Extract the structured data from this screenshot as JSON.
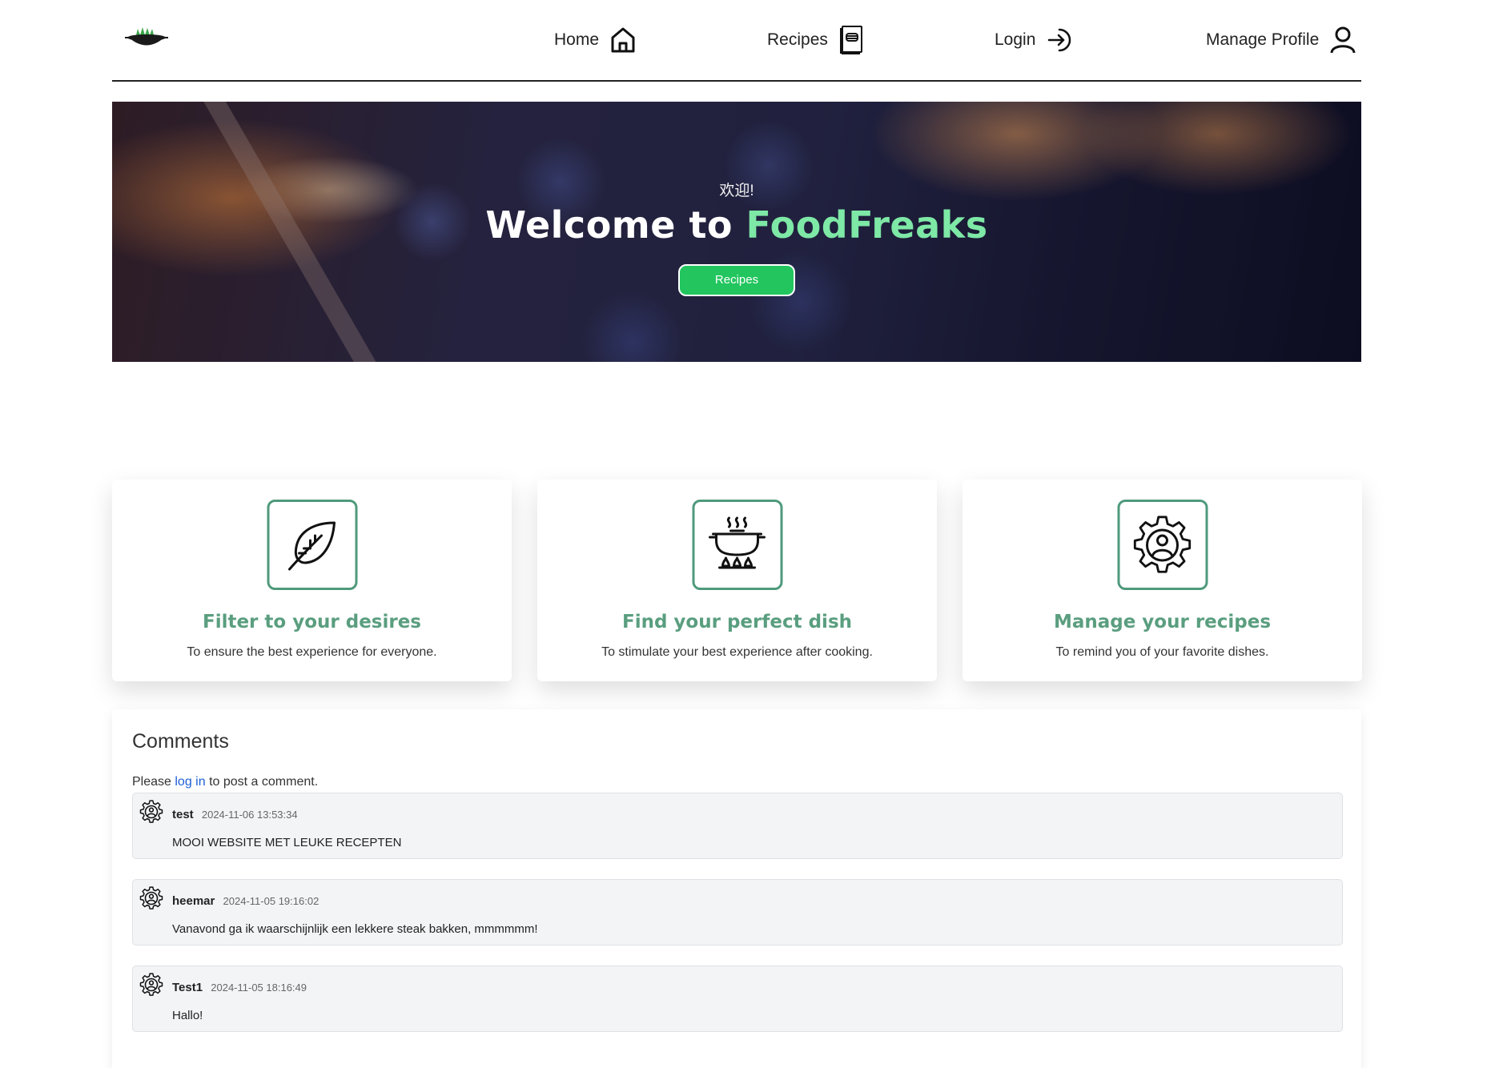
{
  "nav": {
    "home_label": "Home",
    "recipes_label": "Recipes",
    "login_label": "Login",
    "profile_label": "Manage Profile"
  },
  "hero": {
    "greeting": "欢迎!",
    "title_prefix": "Welcome to",
    "brand": "FoodFreaks",
    "button_label": "Recipes",
    "brand_color": "#7ee8a6",
    "button_color": "#22c55e"
  },
  "features": [
    {
      "icon": "leaf-icon",
      "title": "Filter to your desires",
      "text": "To ensure the best experience for everyone."
    },
    {
      "icon": "cooking-pot-icon",
      "title": "Find your perfect dish",
      "text": "To stimulate your best experience after cooking."
    },
    {
      "icon": "gear-user-icon",
      "title": "Manage your recipes",
      "text": "To remind you of your favorite dishes."
    }
  ],
  "comments": {
    "title": "Comments",
    "login_prefix": "Please",
    "login_link": "log in",
    "login_suffix": "to post a comment.",
    "items": [
      {
        "user": "test",
        "date": "2024-11-06 13:53:34",
        "text": "MOOI WEBSITE MET LEUKE RECEPTEN"
      },
      {
        "user": "heemar",
        "date": "2024-11-05 19:16:02",
        "text": "Vanavond ga ik waarschijnlijk een lekkere steak bakken, mmmmmm!"
      },
      {
        "user": "Test1",
        "date": "2024-11-05 18:16:49",
        "text": "Hallo!"
      }
    ]
  },
  "colors": {
    "accent_green": "#5a9e7f",
    "link_blue": "#1d5fd6"
  }
}
